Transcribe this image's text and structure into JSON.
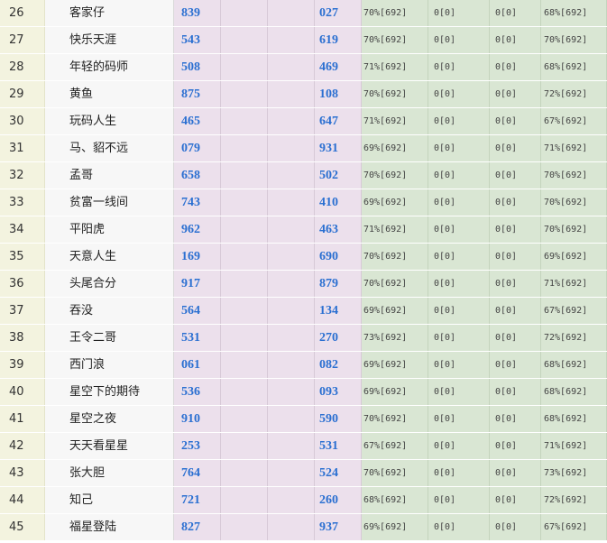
{
  "rows": [
    {
      "rank": "26",
      "name": "客家仔",
      "num1": "839",
      "num2": "027",
      "p1": "70%[692]",
      "p2": "0[0]",
      "p3": "0[0]",
      "p4": "68%[692]"
    },
    {
      "rank": "27",
      "name": "快乐天涯",
      "num1": "543",
      "num2": "619",
      "p1": "70%[692]",
      "p2": "0[0]",
      "p3": "0[0]",
      "p4": "70%[692]"
    },
    {
      "rank": "28",
      "name": "年轻的码师",
      "num1": "508",
      "num2": "469",
      "p1": "71%[692]",
      "p2": "0[0]",
      "p3": "0[0]",
      "p4": "68%[692]"
    },
    {
      "rank": "29",
      "name": "黄鱼",
      "num1": "875",
      "num2": "108",
      "p1": "70%[692]",
      "p2": "0[0]",
      "p3": "0[0]",
      "p4": "72%[692]"
    },
    {
      "rank": "30",
      "name": "玩码人生",
      "num1": "465",
      "num2": "647",
      "p1": "71%[692]",
      "p2": "0[0]",
      "p3": "0[0]",
      "p4": "67%[692]"
    },
    {
      "rank": "31",
      "name": "马、貂不远",
      "num1": "079",
      "num2": "931",
      "p1": "69%[692]",
      "p2": "0[0]",
      "p3": "0[0]",
      "p4": "71%[692]"
    },
    {
      "rank": "32",
      "name": "孟哥",
      "num1": "658",
      "num2": "502",
      "p1": "70%[692]",
      "p2": "0[0]",
      "p3": "0[0]",
      "p4": "70%[692]"
    },
    {
      "rank": "33",
      "name": "贫富一线间",
      "num1": "743",
      "num2": "410",
      "p1": "69%[692]",
      "p2": "0[0]",
      "p3": "0[0]",
      "p4": "70%[692]"
    },
    {
      "rank": "34",
      "name": "平阳虎",
      "num1": "962",
      "num2": "463",
      "p1": "71%[692]",
      "p2": "0[0]",
      "p3": "0[0]",
      "p4": "70%[692]"
    },
    {
      "rank": "35",
      "name": "天意人生",
      "num1": "169",
      "num2": "690",
      "p1": "70%[692]",
      "p2": "0[0]",
      "p3": "0[0]",
      "p4": "69%[692]"
    },
    {
      "rank": "36",
      "name": "头尾合分",
      "num1": "917",
      "num2": "879",
      "p1": "70%[692]",
      "p2": "0[0]",
      "p3": "0[0]",
      "p4": "71%[692]"
    },
    {
      "rank": "37",
      "name": "吞没",
      "num1": "564",
      "num2": "134",
      "p1": "69%[692]",
      "p2": "0[0]",
      "p3": "0[0]",
      "p4": "67%[692]"
    },
    {
      "rank": "38",
      "name": "王令二哥",
      "num1": "531",
      "num2": "270",
      "p1": "73%[692]",
      "p2": "0[0]",
      "p3": "0[0]",
      "p4": "72%[692]"
    },
    {
      "rank": "39",
      "name": "西门浪",
      "num1": "061",
      "num2": "082",
      "p1": "69%[692]",
      "p2": "0[0]",
      "p3": "0[0]",
      "p4": "68%[692]"
    },
    {
      "rank": "40",
      "name": "星空下的期待",
      "num1": "536",
      "num2": "093",
      "p1": "69%[692]",
      "p2": "0[0]",
      "p3": "0[0]",
      "p4": "68%[692]"
    },
    {
      "rank": "41",
      "name": "星空之夜",
      "num1": "910",
      "num2": "590",
      "p1": "70%[692]",
      "p2": "0[0]",
      "p3": "0[0]",
      "p4": "68%[692]"
    },
    {
      "rank": "42",
      "name": "天天看星星",
      "num1": "253",
      "num2": "531",
      "p1": "67%[692]",
      "p2": "0[0]",
      "p3": "0[0]",
      "p4": "71%[692]"
    },
    {
      "rank": "43",
      "name": "张大胆",
      "num1": "764",
      "num2": "524",
      "p1": "70%[692]",
      "p2": "0[0]",
      "p3": "0[0]",
      "p4": "73%[692]"
    },
    {
      "rank": "44",
      "name": "知己",
      "num1": "721",
      "num2": "260",
      "p1": "68%[692]",
      "p2": "0[0]",
      "p3": "0[0]",
      "p4": "72%[692]"
    },
    {
      "rank": "45",
      "name": "福星登陆",
      "num1": "827",
      "num2": "937",
      "p1": "69%[692]",
      "p2": "0[0]",
      "p3": "0[0]",
      "p4": "67%[692]"
    }
  ]
}
